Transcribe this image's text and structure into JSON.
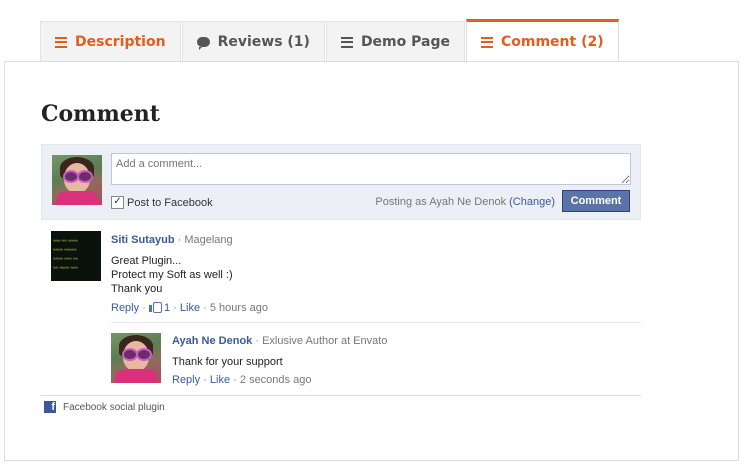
{
  "tabs": [
    {
      "label": "Description",
      "icon": "list-icon"
    },
    {
      "label": "Reviews (1)",
      "icon": "chat-bubble-icon"
    },
    {
      "label": "Demo Page",
      "icon": "list-icon"
    },
    {
      "label": "Comment (2)",
      "icon": "list-icon"
    }
  ],
  "heading": "Comment",
  "compose": {
    "placeholder": "Add a comment...",
    "post_to_facebook": "Post to Facebook",
    "post_to_facebook_checked": true,
    "posting_as_prefix": "Posting as Ayah Ne Denok",
    "change_link": "(Change)",
    "button": "Comment"
  },
  "comments": [
    {
      "author": "Siti Sutayub",
      "meta": "· Magelang",
      "lines": [
        "Great Plugin...",
        "Protect my Soft as well :)",
        "Thank you"
      ],
      "reply": "Reply",
      "like_count": "1",
      "like": "Like",
      "time": "· 5 hours ago"
    },
    {
      "author": "Ayah Ne Denok",
      "meta": "· Exlusive Author at Envato",
      "lines": [
        "Thank for your support"
      ],
      "reply": "Reply",
      "like": "Like",
      "time": "· 2 seconds ago"
    }
  ],
  "footer": {
    "label": "Facebook social plugin"
  },
  "colors": {
    "accent": "#e55c1f",
    "facebook_blue": "#3b5998",
    "button_blue": "#5b74a8"
  }
}
